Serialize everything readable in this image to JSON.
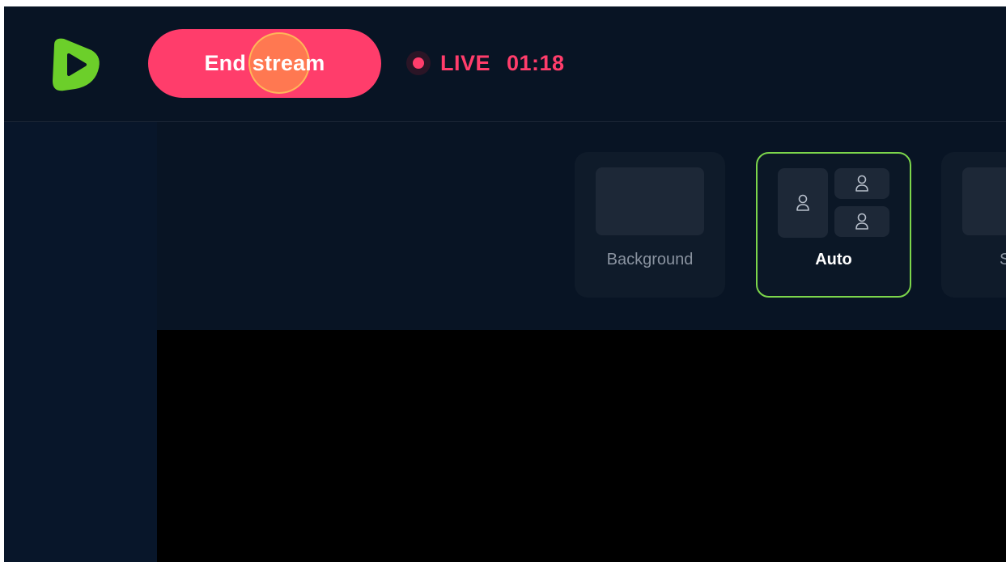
{
  "header": {
    "logo": "play-logo-icon",
    "end_stream_label": "End stream",
    "live_label": "LIVE",
    "live_time": "01:18"
  },
  "layouts": {
    "items": [
      {
        "label": "Background",
        "selected": false
      },
      {
        "label": "Auto",
        "selected": true
      },
      {
        "label": "S",
        "selected": false
      }
    ]
  },
  "colors": {
    "brand_green": "#6ccf2a",
    "live_red": "#ff3d6b",
    "selected_border": "#7cd64b",
    "background": "#081424"
  }
}
